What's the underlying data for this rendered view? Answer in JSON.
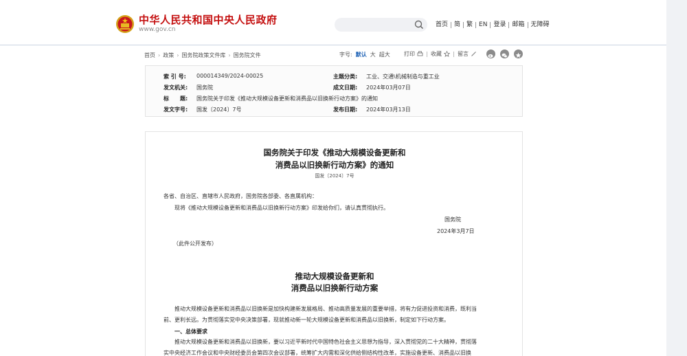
{
  "header": {
    "site_name": "中华人民共和国中央人民政府",
    "site_url": "www.gov.cn",
    "nav": [
      "首页",
      "简",
      "繁",
      "EN",
      "登录",
      "邮箱",
      "无障碍"
    ]
  },
  "breadcrumb": [
    "首页",
    "政策",
    "国务院政策文件库",
    "国务院文件"
  ],
  "font_size": {
    "label": "字号:",
    "options": [
      "默认",
      "大",
      "超大"
    ],
    "active": "默认"
  },
  "tools": [
    "打印",
    "收藏",
    "留言"
  ],
  "info": {
    "index_label": "索 引 号:",
    "index_value": "000014349/2024-00025",
    "topic_label": "主题分类:",
    "topic_value": "工业、交通\\机械制造与重工业",
    "issuer_label": "发文机关:",
    "issuer_value": "国务院",
    "date_label": "成文日期:",
    "date_value": "2024年03月07日",
    "title_label": "标　　题:",
    "title_value": "国务院关于印发《推动大规模设备更新和消费品以旧换新行动方案》的通知",
    "docno_label": "发文字号:",
    "docno_value": "国发〔2024〕7号",
    "pub_label": "发布日期:",
    "pub_value": "2024年03月13日"
  },
  "article": {
    "title_line1": "国务院关于印发《推动大规模设备更新和",
    "title_line2": "消费品以旧换新行动方案》的通知",
    "doc_number": "国发〔2024〕7号",
    "salutation": "各省、自治区、直辖市人民政府，国务院各部委、各直属机构：",
    "body": "现将《推动大规模设备更新和消费品以旧换新行动方案》印发给你们，请认真贯彻执行。",
    "signer": "国务院",
    "sign_date": "2024年3月7日",
    "disclosure": "（此件公开发布）",
    "plan_title_line1": "推动大规模设备更新和",
    "plan_title_line2": "消费品以旧换新行动方案",
    "intro_line1": "推动大规模设备更新和消费品以旧换新是加快构建新发展格局、推动高质量发展的重要举措，将有力促进投资和消费，既利当",
    "intro_line2": "前、更利长远。为贯彻落实党中央决策部署，现就推动新一轮大规模设备更新和消费品以旧换新，制定如下行动方案。",
    "section1": "一、总体要求",
    "s1_line1": "推动大规模设备更新和消费品以旧换新，要以习近平新时代中国特色社会主义思想为指导，深入贯彻党的二十大精神，贯彻落",
    "s1_line2": "实中央经济工作会议和中央财经委员会第四次会议部署，统筹扩大内需和深化供给侧结构性改革，实施设备更新、消费品以旧换"
  }
}
